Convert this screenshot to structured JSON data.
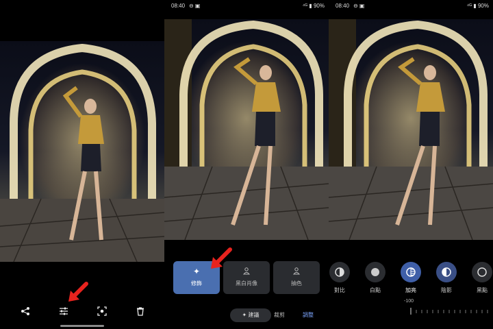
{
  "status": {
    "time": "08:40",
    "battery": "90%"
  },
  "panel2": {
    "effects": [
      {
        "label": "修飾",
        "icon": "sparkle-icon"
      },
      {
        "label": "黑白肖像",
        "icon": "portrait-icon"
      },
      {
        "label": "抽色",
        "icon": "color-pop-icon"
      }
    ],
    "tabs": {
      "suggest": "建議",
      "crop": "裁剪",
      "adjust": "調整"
    }
  },
  "panel3": {
    "adjust_items": [
      {
        "label": "對比",
        "icon": "contrast-icon"
      },
      {
        "label": "白點",
        "icon": "white-point-icon"
      },
      {
        "label": "加亮",
        "icon": "highlights-icon",
        "selected": true
      },
      {
        "label": "陰影",
        "icon": "shadows-icon"
      },
      {
        "label": "黑點",
        "icon": "black-point-icon"
      }
    ],
    "slider_value": "-100"
  },
  "panel1": {
    "toolbar_icons": [
      "share-icon",
      "edit-adjust-icon",
      "lens-icon",
      "delete-icon"
    ]
  },
  "colors": {
    "accent": "#4a6fb0",
    "arrow": "#e8231e"
  }
}
